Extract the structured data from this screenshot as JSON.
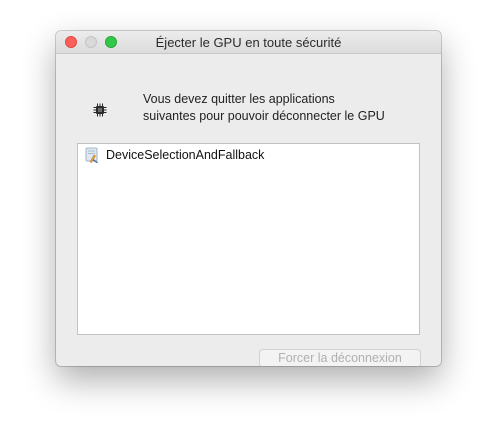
{
  "window": {
    "title": "Éjecter le GPU en toute sécurité"
  },
  "icons": {
    "close": "close-button",
    "minimize": "minimize-button",
    "zoom": "zoom-button",
    "gpu": "chip-icon",
    "app": "xcode-app-icon"
  },
  "message": {
    "line1": "Vous devez quitter les applications",
    "line2": "suivantes pour pouvoir déconnecter le GPU"
  },
  "apps": [
    {
      "name": "DeviceSelectionAndFallback"
    }
  ],
  "buttons": {
    "force_disconnect": "Forcer la déconnexion"
  },
  "colors": {
    "close": "#fc605c",
    "minimize": "#d9d9d9",
    "zoom": "#34c84a",
    "window_bg": "#ececec",
    "disabled_text": "#b0b0b0"
  }
}
